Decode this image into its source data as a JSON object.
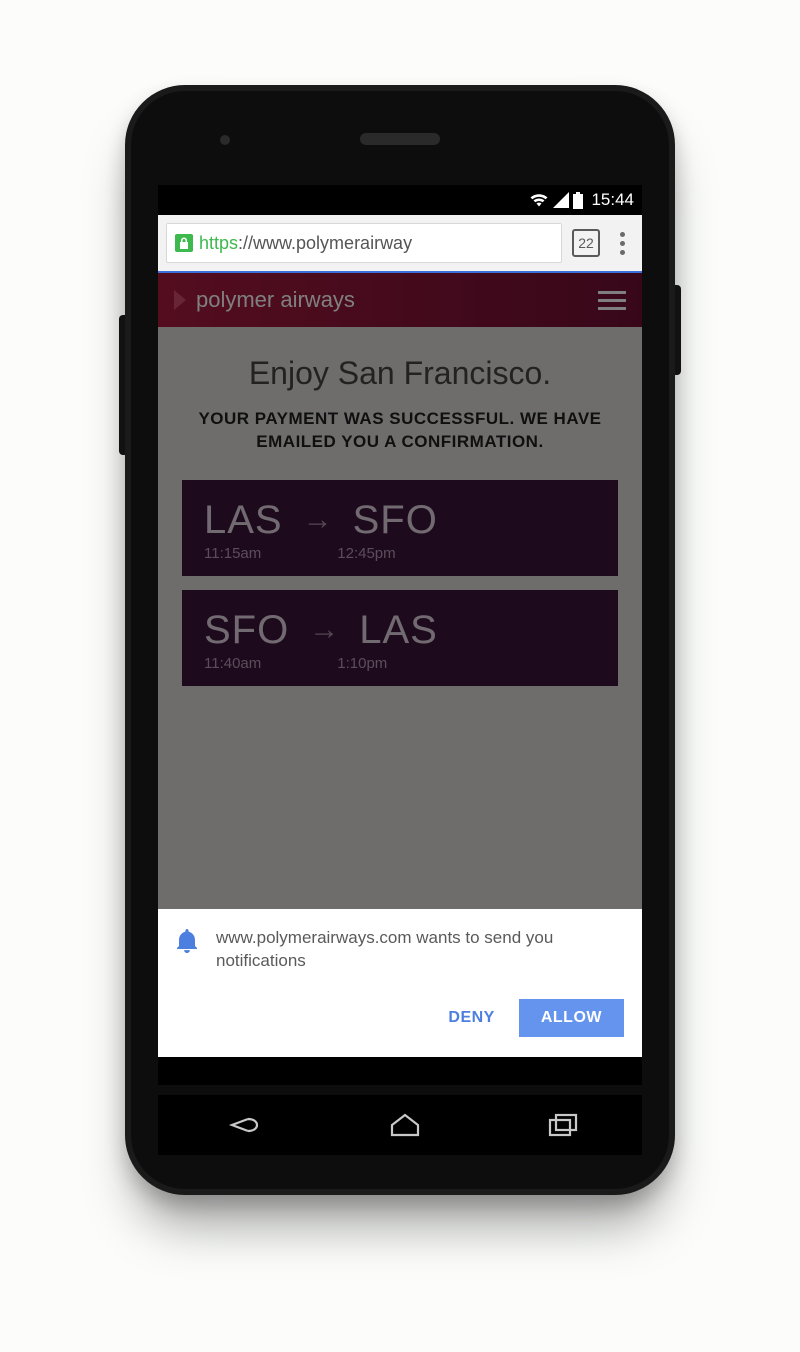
{
  "status": {
    "time": "15:44"
  },
  "browser": {
    "scheme": "https",
    "url_rest": "://www.polymerairway",
    "tab_count": "22"
  },
  "app": {
    "brand": "polymer airways",
    "hero_title": "Enjoy San Francisco.",
    "hero_sub": "YOUR PAYMENT WAS SUCCESSFUL. WE HAVE EMAILED YOU A CONFIRMATION.",
    "flights": [
      {
        "from": "LAS",
        "to": "SFO",
        "dep": "11:15am",
        "arr": "12:45pm"
      },
      {
        "from": "SFO",
        "to": "LAS",
        "dep": "11:40am",
        "arr": "1:10pm"
      }
    ]
  },
  "permission": {
    "text": "www.polymerairways.com wants to send you notifications",
    "deny": "DENY",
    "allow": "ALLOW"
  }
}
